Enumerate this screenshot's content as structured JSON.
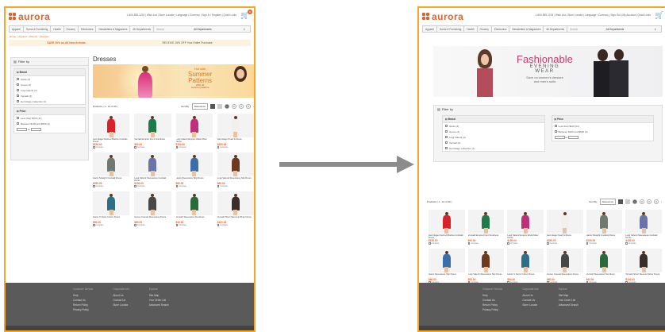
{
  "brand": {
    "name": "aurora",
    "accent": "#e4612b",
    "frame_color": "#f5a623"
  },
  "header": {
    "utility_links": "1-800-555-1234 | Wish List | Store Locator | Language / Currency | Sign In / Register | Quick Links",
    "utility_links_right": "1-800-555-1234 | Wish List | Store Locator | Language / Currency | Sign Out | My Account | Quick Links",
    "cart_count": "0"
  },
  "nav": {
    "items": [
      "Apparel",
      "Home & Furnishing",
      "Health",
      "Grocery",
      "Electronics",
      "Newsletters & Magazines",
      "All Departments"
    ],
    "search_placeholder": "Search",
    "search_scope": "All Departments"
  },
  "breadcrumb": "Home > Apparel > Women > Dresses",
  "promo": {
    "left": "SAVE 20% on All New Arrivals",
    "right": "RECEIVE 15% OFF Your Entire Purchase"
  },
  "filter": {
    "title": "Filter by",
    "brand_header": "Brand",
    "brands": [
      "Hanis (4)",
      "Gusso (4)",
      "Luigi Valenti (4)",
      "Versatil (4)",
      "Hermitage Collection (1)"
    ],
    "price_header": "Price",
    "prices": [
      "Less than $100 (11)",
      "Between $100 and $500 (4)"
    ],
    "range_to": "to"
  },
  "main": {
    "title": "Dresses"
  },
  "banner": {
    "line1": "Hot with",
    "line2": "Summer",
    "line3": "Patterns",
    "line4": "20% off",
    "line5": "summer patterns"
  },
  "hero": {
    "title": "Fashionable",
    "sub1": "EVENING",
    "sub2": "WEAR",
    "caption1": "Save on women's dresses",
    "caption2": "and men's suits"
  },
  "toolbar": {
    "products_label": "Products ( 1 - 12 of 26 )",
    "sort_label": "Sort By:",
    "sort_value": "Relevance",
    "pages": [
      "1",
      "2",
      "3",
      "4"
    ],
    "next": "›"
  },
  "products": [
    {
      "name": "Hermitage Ruched Bodice Cocktail Dress",
      "price": "$150.00",
      "color": "#d8232a"
    },
    {
      "name": "Versatil Empire Front Sundress",
      "price": "$90.00",
      "color": "#1f7a4a"
    },
    {
      "name": "Luigi Valenti Empire Waist Maxi Dress",
      "price": "$150.00",
      "color": "#c0307a"
    },
    {
      "name": "Hermitage Pearl & Dress",
      "price": "$250.00",
      "color": "#f2f0ec"
    },
    {
      "name": "Hanis Straight Cocktail Dress",
      "price": "$250.00",
      "color": "#6f7a6e"
    },
    {
      "name": "Luigi Valenti Sleeveless Cocktail Dress",
      "price": "$150.00",
      "color": "#6b74a8"
    },
    {
      "name": "Hanis Sleeveless Slip Dress",
      "price": "$80.00",
      "color": "#3a6fa8"
    },
    {
      "name": "Luigi Valenti Sleeveless Slip Dress",
      "price": "$80.00",
      "color": "#6b3a1f"
    },
    {
      "name": "Hanis V-Neck Cotton Dress",
      "price": "$90.00",
      "color": "#2d6f86"
    },
    {
      "name": "Gusso Casual Sleeveless Dress",
      "price": "$80.00",
      "color": "#474747"
    },
    {
      "name": "Versatil Sleeveless Sundress",
      "price": "$40.00",
      "color": "#2b6a3a"
    },
    {
      "name": "Versatil Short Sleeved Wrap Dress",
      "price": "$100.00",
      "color": "#3a2d2a"
    }
  ],
  "compare_label": "Compare",
  "footer": {
    "col1": {
      "title": "Customer Service",
      "links": [
        "Help",
        "Contact Us",
        "Return Policy",
        "Privacy Policy"
      ]
    },
    "col2": {
      "title": "Corporate Info",
      "links": [
        "About Us",
        "Contact Us",
        "Store Locator"
      ]
    },
    "col3": {
      "title": "Explore",
      "links": [
        "Site Map",
        "Your Order List",
        "Advanced Search"
      ]
    }
  },
  "arrow_color": "#8c8c8c"
}
